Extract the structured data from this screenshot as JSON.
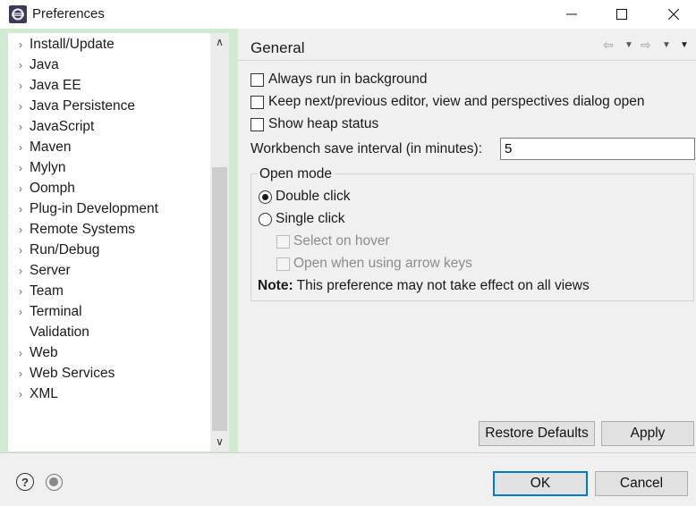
{
  "window": {
    "title": "Preferences",
    "minimize": "—",
    "maximize": "☐",
    "close": "✕"
  },
  "filter": {
    "value": "",
    "placeholder": ""
  },
  "tree": {
    "items": [
      {
        "label": "Install/Update",
        "expandable": true
      },
      {
        "label": "Java",
        "expandable": true
      },
      {
        "label": "Java EE",
        "expandable": true
      },
      {
        "label": "Java Persistence",
        "expandable": true
      },
      {
        "label": "JavaScript",
        "expandable": true
      },
      {
        "label": "Maven",
        "expandable": true
      },
      {
        "label": "Mylyn",
        "expandable": true
      },
      {
        "label": "Oomph",
        "expandable": true
      },
      {
        "label": "Plug-in Development",
        "expandable": true
      },
      {
        "label": "Remote Systems",
        "expandable": true
      },
      {
        "label": "Run/Debug",
        "expandable": true
      },
      {
        "label": "Server",
        "expandable": true
      },
      {
        "label": "Team",
        "expandable": true
      },
      {
        "label": "Terminal",
        "expandable": true
      },
      {
        "label": "Validation",
        "expandable": false
      },
      {
        "label": "Web",
        "expandable": true
      },
      {
        "label": "Web Services",
        "expandable": true
      },
      {
        "label": "XML",
        "expandable": true
      }
    ],
    "arrow_glyph": "›"
  },
  "scroll": {
    "up": "∧",
    "down": "∨"
  },
  "page": {
    "title": "General",
    "nav_back": "⇦",
    "nav_forward": "⇨",
    "drop": "▼"
  },
  "options": {
    "always_run_bg": "Always run in background",
    "keep_editor_dialog": "Keep next/previous editor, view and perspectives dialog open",
    "show_heap": "Show heap status",
    "save_interval_label": "Workbench save interval (in minutes):",
    "save_interval_value": "5"
  },
  "open_mode": {
    "title": "Open mode",
    "double_click": "Double click",
    "single_click": "Single click",
    "select_on_hover": "Select on hover",
    "open_arrow_keys": "Open when using arrow keys",
    "note_label": "Note:",
    "note_text": " This preference may not take effect on all views"
  },
  "buttons": {
    "restore_defaults": "Restore Defaults",
    "apply": "Apply",
    "ok": "OK",
    "cancel": "Cancel"
  },
  "bottom": {
    "help": "?"
  },
  "colors": {
    "left_pane_bg": "#d2e9d2",
    "default_button_border": "#0078d7"
  }
}
